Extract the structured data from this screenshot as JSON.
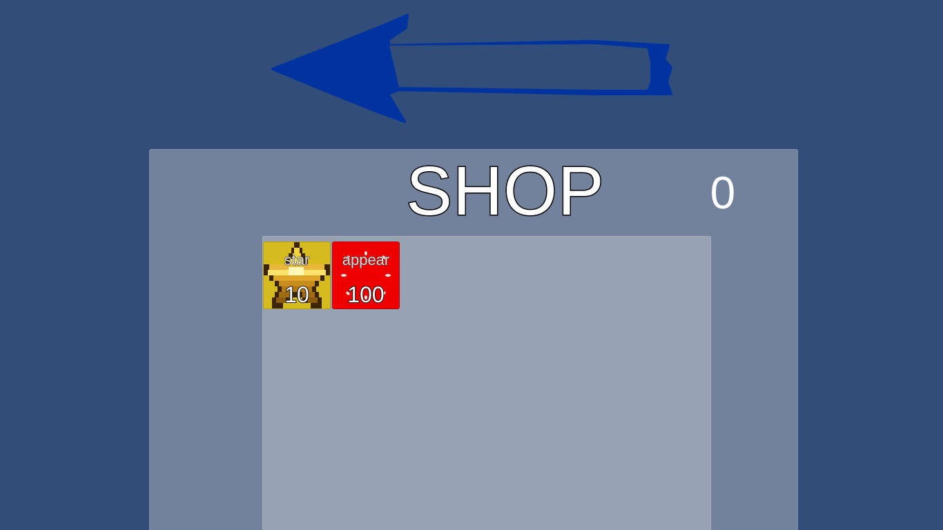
{
  "back_arrow": {
    "icon": "left-arrow-icon",
    "color": "#0033a0"
  },
  "shop": {
    "title": "SHOP",
    "coins": "0",
    "panel_color": "#72829c",
    "area_color": "#96a2b2"
  },
  "items": [
    {
      "name": "star",
      "price": "10",
      "icon": "star-icon",
      "color": "#d6bb1f"
    },
    {
      "name": "appear",
      "price": "100",
      "icon": "sparkle-icon",
      "color": "#ee0000"
    }
  ]
}
